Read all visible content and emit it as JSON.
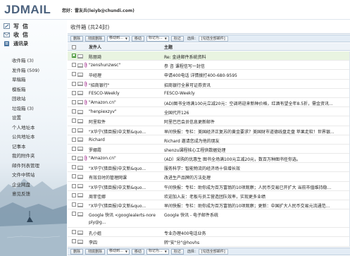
{
  "header": {
    "logo": "JDMAIL",
    "greeting_prefix": "您好：",
    "user": "雷友兵(leiyb@chundi.com)"
  },
  "sidebar": {
    "write_label": "写信",
    "receive_label": "收信",
    "contacts_label": "通讯录",
    "folders": [
      "收件箱 (3)",
      "发件箱 (509)",
      "草稿箱",
      "模板箱",
      "回收站",
      "垃圾箱 (3)",
      "设置",
      "个人地址本",
      "公共地址本",
      "记事本",
      "我的附件夹",
      "邮件列表管理",
      "文件中转站",
      "企业网盘",
      "意见反馈"
    ]
  },
  "main": {
    "title": "收件箱 (共24封)",
    "toolbar": {
      "delete": "删除",
      "delete_perm": "彻底删除",
      "move_to": "移动到...",
      "move": "移动",
      "mark_as": "标记为...",
      "mark": "标记",
      "select_label": "选择：",
      "select_all": "[勾选全部邮件]"
    },
    "columns": {
      "sender": "发件人",
      "subject": "主题"
    },
    "rows": [
      {
        "sender": "陈丽琦",
        "subject": "Re: 金迪邮件系统资料",
        "selected": true,
        "checked": true,
        "attachment": false
      },
      {
        "sender": "\"zenshunzwsc\"",
        "subject": "参 咨 课程信写一封信",
        "selected": false,
        "checked": false,
        "attachment": true
      },
      {
        "sender": "毕经理",
        "subject": "申请400电话 详情拨打400-680-9595",
        "selected": false,
        "checked": false,
        "attachment": false
      },
      {
        "sender": "\"招商银行\"",
        "subject": "招商银行全景可证券资讯",
        "selected": false,
        "checked": false,
        "attachment": true
      },
      {
        "sender": "FESCO-Weekly",
        "subject": "FESCO-Weekly",
        "selected": false,
        "checked": false,
        "attachment": false
      },
      {
        "sender": "\"Amazon.cn\"",
        "subject": "(AD)图书全场满100元立减20元：空调将迎来新种价格，红酒有望全年8.5折，需金资讯...",
        "selected": false,
        "checked": false,
        "attachment": true
      },
      {
        "sender": "\"henpiexzyv\"",
        "subject": "全国代开126",
        "selected": false,
        "checked": false,
        "attachment": false
      },
      {
        "sender": "阿里软件",
        "subject": "阿里巴巴会员信息更新邮件",
        "selected": false,
        "checked": false,
        "attachment": false
      },
      {
        "sender": "\"X华宁(猎目报)中文新&quo...",
        "subject": "早间快报：专栏：美国经济正复苏的黄金要求？美国财市道德线盘走盘 苹果走软！世界银...",
        "selected": false,
        "checked": false,
        "attachment": false
      },
      {
        "sender": "Richard",
        "subject": "Richard 邀请您成为他的朋友",
        "selected": false,
        "checked": false,
        "attachment": false
      },
      {
        "sender": "罗娜霞",
        "subject": "shenzu课程核心工程供数据处理",
        "selected": false,
        "checked": false,
        "attachment": false
      },
      {
        "sender": "\"Amazon.cn\"",
        "subject": "(AD）采购的优惠生 图书全场满100元立减20元，数百万种图书任你选。",
        "selected": false,
        "checked": false,
        "attachment": true
      },
      {
        "sender": "\"X华宁(猎目报)中文新&quo...",
        "subject": "服务科学：智能物流的经济场十倍增长效",
        "selected": false,
        "checked": false,
        "attachment": false
      },
      {
        "sender": "有效日时的管理网课",
        "subject": "改进生产品牌的方法处理",
        "selected": false,
        "checked": false,
        "attachment": false
      },
      {
        "sender": "\"X华宁(猎目报)中文新&quo...",
        "subject": "午间快报：专栏：助你成为百万富翁的10项观察；人民币交易已开扩大 当前市值维持稳...",
        "selected": false,
        "checked": false,
        "attachment": false
      },
      {
        "sender": "周菲佳娜",
        "subject": "欢迎加入友：老板与员工营造团队效率，实现更多业绩",
        "selected": false,
        "checked": false,
        "attachment": false
      },
      {
        "sender": "\"X华宁(猎目报)中文新&quo...",
        "subject": "早间快报：专栏：助你成为百万富翁的10项观察；更新：中国扩大人民币交易元流通范...",
        "selected": false,
        "checked": false,
        "attachment": false
      },
      {
        "sender": "Google 快讯 <googlealerts-nore",
        "sender_line2": "ply@g...",
        "subject": "Google 快讯 - 电子邮件系统",
        "selected": false,
        "checked": false,
        "attachment": false,
        "tall": true
      },
      {
        "sender": "孔小姐",
        "subject": "专业办理400电话业务",
        "selected": false,
        "checked": false,
        "attachment": false
      },
      {
        "sender": "李四",
        "subject": "转\"安\"分\"@hovhs",
        "selected": false,
        "checked": false,
        "attachment": false
      }
    ]
  }
}
